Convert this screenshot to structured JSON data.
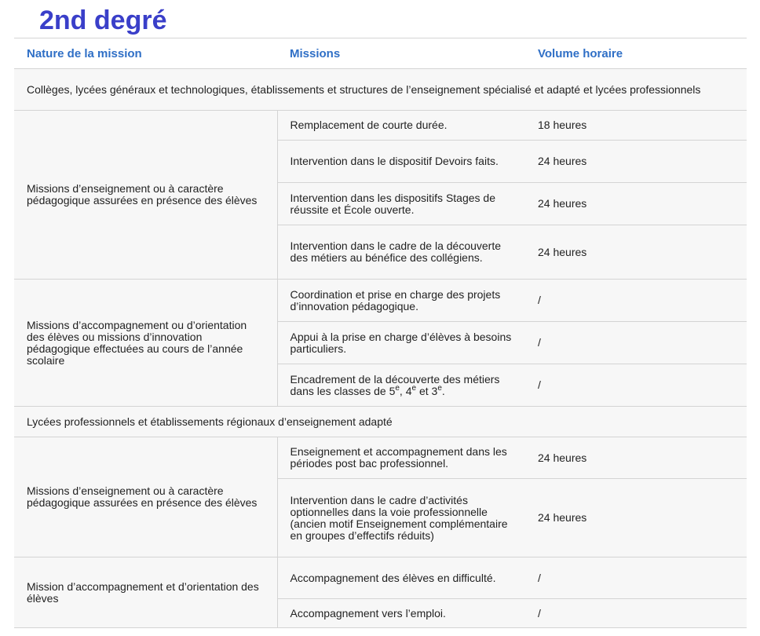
{
  "page": {
    "title": "2nd degré"
  },
  "table": {
    "headers": {
      "nature": "Nature de la mission",
      "missions": "Missions",
      "volume": "Volume horaire"
    },
    "sections": [
      {
        "label": "Collèges, lycées généraux et technologiques, établissements et structures de l’enseignement spécialisé et adapté et lycées professionnels",
        "groups": [
          {
            "nature": "Missions d’enseignement ou à caractère pédagogique assurées en présence des élèves",
            "rows": [
              {
                "mission": "Remplacement de courte durée.",
                "volume": "18 heures"
              },
              {
                "mission": "Intervention dans le dispositif Devoirs faits.",
                "volume": "24 heures"
              },
              {
                "mission": "Intervention dans les dispositifs Stages de réussite et École ouverte.",
                "volume": "24 heures"
              },
              {
                "mission": "Intervention dans le cadre de la découverte des métiers au bénéfice des collégiens.",
                "volume": "24 heures"
              }
            ]
          },
          {
            "nature": "Missions d’accompagnement ou d’orientation des élèves ou missions d’innovation pédagogique effectuées au cours de l’année scolaire",
            "rows": [
              {
                "mission": "Coordination et prise en charge des projets d’innovation pédagogique.",
                "volume": "/"
              },
              {
                "mission": "Appui à la prise en charge d’élèves à besoins particuliers.",
                "volume": "/"
              },
              {
                "mission_prefix": "Encadrement de la découverte des métiers dans les classes de 5",
                "sup1": "e",
                "sep1": ", 4",
                "sup2": "e",
                "sep2": " et 3",
                "sup3": "e",
                "mission_suffix": ".",
                "volume": "/"
              }
            ]
          }
        ]
      },
      {
        "label": "Lycées professionnels et établissements régionaux d’enseignement adapté",
        "groups": [
          {
            "nature": "Missions d’enseignement ou à caractère pédagogique assurées en présence des élèves",
            "rows": [
              {
                "mission": "Enseignement et accompagnement dans les périodes post bac professionnel.",
                "volume": "24 heures"
              },
              {
                "mission": "Intervention dans le cadre d’activités optionnelles dans la voie professionnelle (ancien motif Enseignement complémentaire en groupes d’effectifs réduits)",
                "volume": "24 heures"
              }
            ]
          },
          {
            "nature": "Mission d’accompagnement et d’orientation des élèves",
            "rows": [
              {
                "mission": "Accompagnement des élèves en difficulté.",
                "volume": "/"
              },
              {
                "mission": "Accompagnement vers l’emploi.",
                "volume": "/"
              }
            ]
          }
        ]
      }
    ]
  },
  "colors": {
    "title": "#3a3fc9",
    "header_text": "#2f6fc6",
    "row_background": "#f7f7f7",
    "border": "#d4d4d4"
  }
}
